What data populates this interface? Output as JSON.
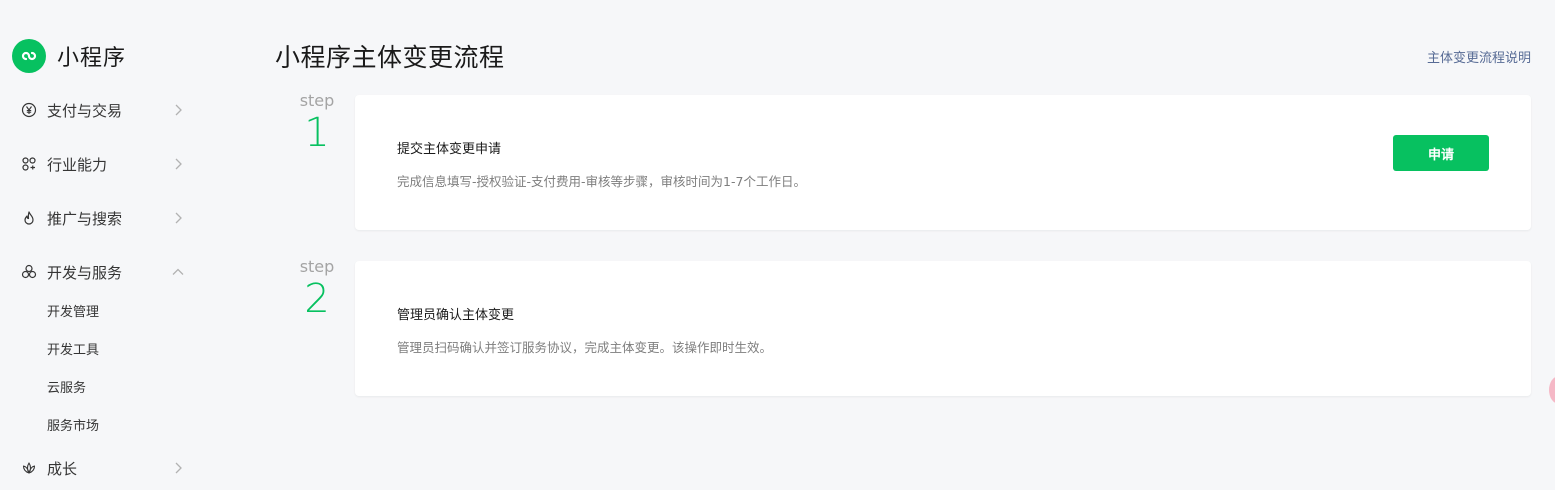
{
  "app": {
    "name": "小程序",
    "logo_icon": "miniprogram-link-icon",
    "accent": "#07c160"
  },
  "sidebar": {
    "items": [
      {
        "label": "支付与交易",
        "icon": "yen-circle-icon",
        "expanded": false
      },
      {
        "label": "行业能力",
        "icon": "cluster-icon",
        "expanded": false
      },
      {
        "label": "推广与搜索",
        "icon": "flame-icon",
        "expanded": false
      },
      {
        "label": "开发与服务",
        "icon": "three-circles-icon",
        "expanded": true
      },
      {
        "label": "成长",
        "icon": "lotus-icon",
        "expanded": false
      }
    ],
    "sub_items": [
      "开发管理",
      "开发工具",
      "云服务",
      "服务市场"
    ]
  },
  "header": {
    "title": "小程序主体变更流程",
    "help_link": "主体变更流程说明"
  },
  "steps": [
    {
      "step_word": "step",
      "number": "1",
      "title": "提交主体变更申请",
      "description": "完成信息填写-授权验证-支付费用-审核等步骤，审核时间为1-7个工作日。",
      "button_label": "申请"
    },
    {
      "step_word": "step",
      "number": "2",
      "title": "管理员确认主体变更",
      "description": "管理员扫码确认并签订服务协议，完成主体变更。该操作即时生效。"
    }
  ]
}
